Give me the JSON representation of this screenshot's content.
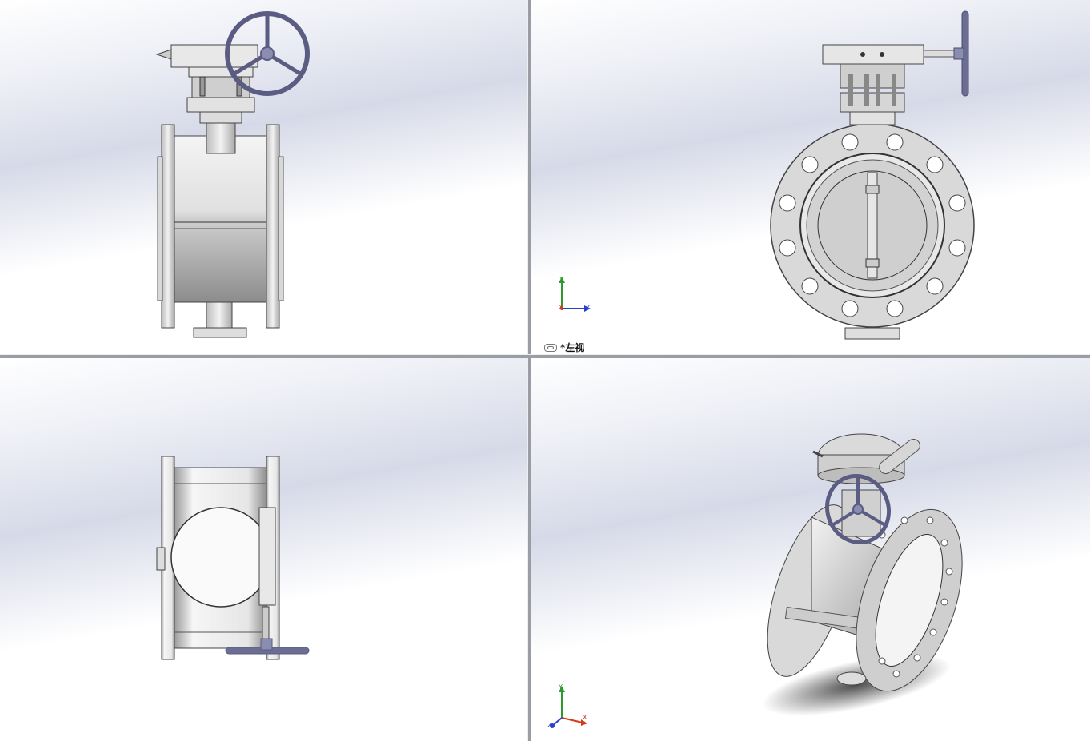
{
  "viewports": {
    "top_left": {
      "name": "front-view"
    },
    "top_right": {
      "name": "left-view",
      "view_label": "*左视",
      "triad": {
        "x": "X",
        "y": "Y",
        "z": "Z"
      }
    },
    "bottom_left": {
      "name": "top-view"
    },
    "bottom_right": {
      "name": "isometric-view",
      "triad": {
        "x": "X",
        "y": "Y",
        "z": "Z"
      }
    }
  },
  "colors": {
    "metal_light": "#e6e6e6",
    "metal_dark": "#8a8a8a",
    "handwheel": "#5a5c82",
    "axis_x": "#d23a1a",
    "axis_y": "#2e9a2e",
    "axis_z": "#2a3ed0"
  }
}
